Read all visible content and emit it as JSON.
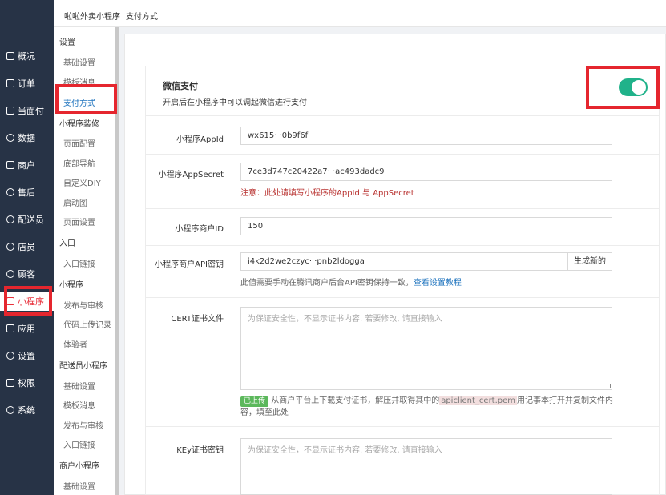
{
  "nav": {
    "items": [
      {
        "label": "概况",
        "icon": "overview-icon"
      },
      {
        "label": "订单",
        "icon": "order-icon"
      },
      {
        "label": "当面付",
        "icon": "face-pay-icon"
      },
      {
        "label": "数据",
        "icon": "data-icon"
      },
      {
        "label": "商户",
        "icon": "merchant-icon"
      },
      {
        "label": "售后",
        "icon": "after-sale-icon"
      },
      {
        "label": "配送员",
        "icon": "courier-icon"
      },
      {
        "label": "店员",
        "icon": "clerk-icon"
      },
      {
        "label": "顾客",
        "icon": "customer-icon"
      },
      {
        "label": "小程序",
        "icon": "miniapp-icon"
      },
      {
        "label": "应用",
        "icon": "apps-icon"
      },
      {
        "label": "设置",
        "icon": "settings-icon"
      },
      {
        "label": "权限",
        "icon": "lock-icon"
      },
      {
        "label": "系统",
        "icon": "system-icon"
      }
    ],
    "active_index": 9
  },
  "header": {
    "app_name": "啦啦外卖小程序",
    "breadcrumb": "支付方式"
  },
  "sub_menu": {
    "sections": [
      {
        "title": "设置",
        "items": [
          "基础设置",
          "模板消息",
          "支付方式"
        ]
      },
      {
        "title": "小程序装修",
        "items": [
          "页面配置",
          "底部导航",
          "自定义DIY",
          "启动图",
          "页面设置"
        ]
      },
      {
        "title": "入口",
        "items": [
          "入口链接"
        ]
      },
      {
        "title": "小程序",
        "items": [
          "发布与审核",
          "代码上传记录",
          "体验者"
        ]
      },
      {
        "title": "配送员小程序",
        "items": [
          "基础设置",
          "模板消息",
          "发布与审核",
          "入口链接"
        ]
      },
      {
        "title": "商户小程序",
        "items": [
          "基础设置"
        ]
      }
    ],
    "active_item": "支付方式"
  },
  "wechat_pay": {
    "title": "微信支付",
    "description": "开启后在小程序中可以调起微信进行支付",
    "enabled": true,
    "toggle_color": "#20b28a"
  },
  "form": {
    "appid": {
      "label": "小程序AppId",
      "value": "wx615·        ·0b9f6f"
    },
    "appsecret": {
      "label": "小程序AppSecret",
      "value": "7ce3d747c20422a7·              ·ac493dadc9",
      "note": "注意：此处请填写小程序的AppId 与 AppSecret"
    },
    "mch_id": {
      "label": "小程序商户ID",
      "value": "150"
    },
    "api_key": {
      "label": "小程序商户API密钥",
      "value": "i4k2d2we2czyc·              ·pnb2ldogga",
      "button": "生成新的",
      "note": "此值需要手动在腾讯商户后台API密钥保持一致，",
      "note_link": "查看设置教程"
    },
    "cert": {
      "label": "CERT证书文件",
      "placeholder": "为保证安全性，不显示证书内容. 若要修改, 请直接输入",
      "badge": "已上传",
      "note_pre": "从商户平台上下载支付证书，解压并取得其中的",
      "note_code": "apiclient_cert.pem",
      "note_post": "用记事本打开并复制文件内容，填至此处"
    },
    "key": {
      "label": "KEy证书密钥",
      "placeholder": "为保证安全性，不显示证书内容. 若要修改, 请直接输入"
    }
  },
  "colors": {
    "nav_bg": "#273346",
    "highlight": "#e5262e",
    "link": "#1e73be",
    "warning": "#b8312f"
  }
}
